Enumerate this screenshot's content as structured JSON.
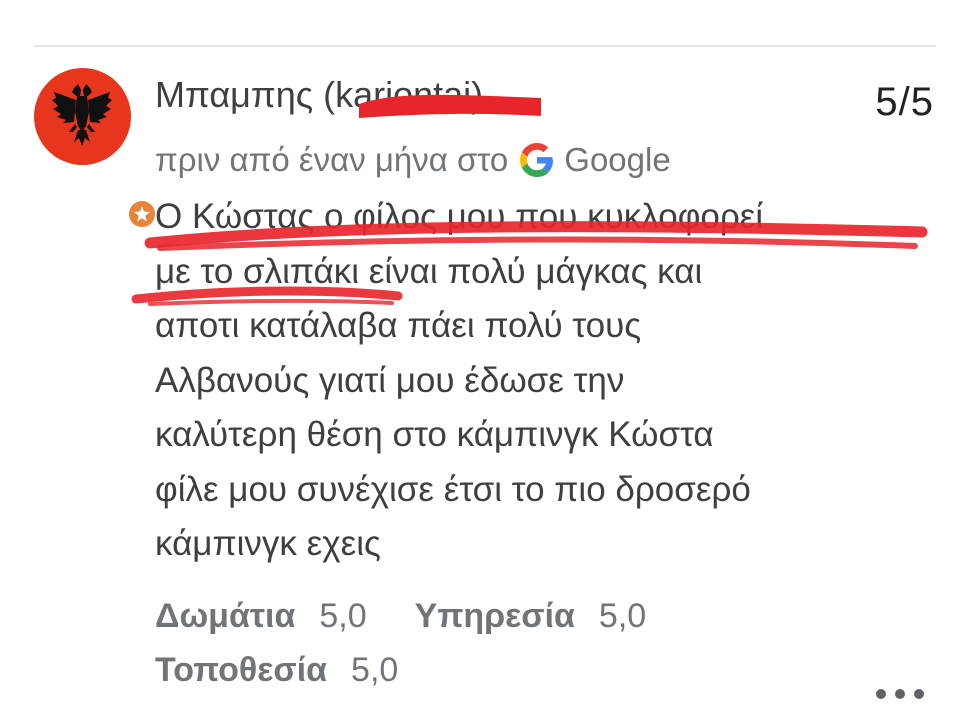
{
  "review": {
    "author_name": "Μπαμπης (",
    "author_name_redacted_suffix": "karjontai)",
    "score": "5/5",
    "time_ago_prefix": "πριν από έναν μήνα στο",
    "source_name": "Google",
    "text_lines": [
      "Ο Κώστας ο φίλος μου που κυκλοφορεί",
      "με το σλιπάκι είναι πολύ μάγκας και",
      "αποτι κατάλαβα πάει πολύ τους",
      "Αλβανούς γιατί μου έδωσε την",
      "καλύτερη θέση στο κάμπινγκ Κώστα",
      "φίλε μου συνέχισε έτσι το πιο δροσερό",
      "κάμπινγκ εχεις"
    ],
    "aspect_ratings": [
      [
        {
          "label": "Δωμάτια",
          "value": "5,0"
        },
        {
          "label": "Υπηρεσία",
          "value": "5,0"
        }
      ],
      [
        {
          "label": "Τοποθεσία",
          "value": "5,0"
        }
      ]
    ]
  },
  "icons": {
    "avatar": "albanian-flag-eagle",
    "badge": "local-guide-star",
    "source": "google-g-logo",
    "menu": "more-dots"
  },
  "colors": {
    "avatar_bg": "#e8361e",
    "scribble": "#e8252b",
    "badge": "#e8833a"
  }
}
